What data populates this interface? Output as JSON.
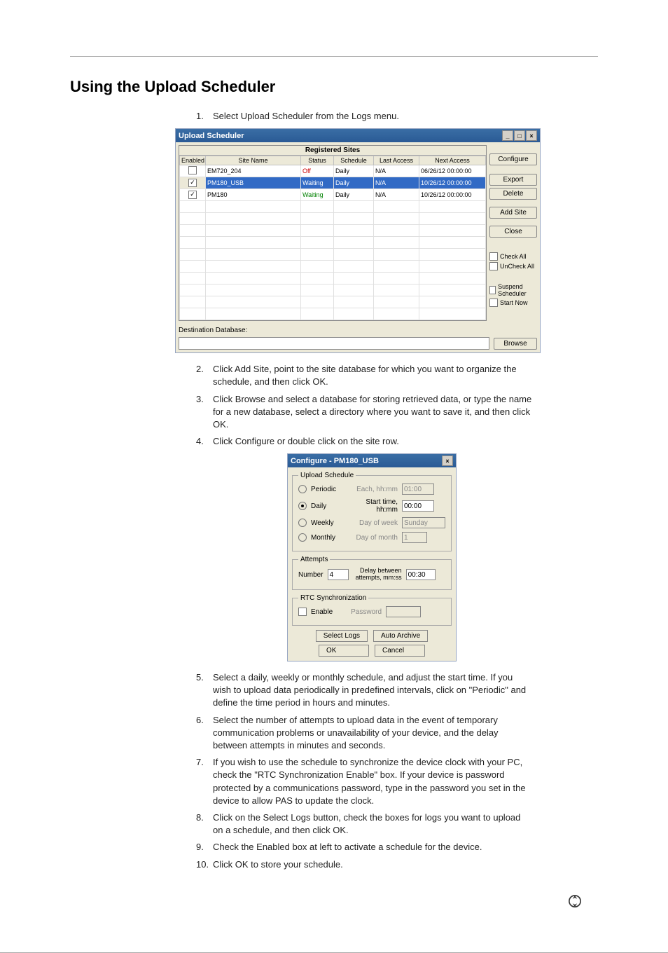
{
  "heading": "Using the Upload Scheduler",
  "steps": {
    "s1": "Select Upload Scheduler from the Logs menu.",
    "s2": "Click Add Site, point to the site database for which you want to organize the schedule, and then click OK.",
    "s3": "Click Browse and select a database for storing retrieved data, or type the name for a new database, select a directory where you want to save it, and then click OK.",
    "s4": "Click Configure or double click on the site row.",
    "s5": "Select a daily, weekly or monthly schedule, and adjust the start time. If you wish to upload data periodically in predefined intervals, click on \"Periodic\" and define the time period in hours and minutes.",
    "s6": "Select the number of attempts to upload data in the event of temporary communication problems or unavailability of your device, and the delay between attempts in minutes and seconds.",
    "s7": "If you wish to use the schedule to synchronize the device clock with your PC, check the \"RTC Synchronization Enable\" box. If your device is password protected by a communications password, type in the password you set in the device to allow PAS to update the clock.",
    "s8": "Click on the Select Logs button, check the boxes for logs you want to upload on a schedule, and then click OK.",
    "s9": "Check the Enabled box at left to activate a schedule for the device.",
    "s10": "Click OK to store your schedule."
  },
  "scheduler": {
    "title": "Upload Scheduler",
    "grid_title": "Registered Sites",
    "headers": {
      "enabled": "Enabled",
      "site": "Site Name",
      "status": "Status",
      "schedule": "Schedule",
      "last": "Last Access",
      "next": "Next Access"
    },
    "rows": [
      {
        "checked": false,
        "site": "EM720_204",
        "status": "Off",
        "status_class": "red",
        "schedule": "Daily",
        "last": "N/A",
        "next": "06/26/12 00:00:00",
        "selected": false
      },
      {
        "checked": true,
        "site": "PM180_USB",
        "status": "Waiting",
        "status_class": "green",
        "schedule": "Daily",
        "last": "N/A",
        "next": "10/26/12 00:00:00",
        "selected": true
      },
      {
        "checked": true,
        "site": "PM180",
        "status": "Waiting",
        "status_class": "green",
        "schedule": "Daily",
        "last": "N/A",
        "next": "10/26/12 00:00:00",
        "selected": false
      }
    ],
    "buttons": {
      "configure": "Configure",
      "export": "Export",
      "delete": "Delete",
      "add": "Add Site",
      "close": "Close",
      "browse": "Browse"
    },
    "checks": {
      "checkall": "Check All",
      "uncheckall": "UnCheck All",
      "suspend": "Suspend Scheduler",
      "startnow": "Start Now"
    },
    "dest_label": "Destination Database:"
  },
  "configure": {
    "title": "Configure - PM180_USB",
    "group_upload": "Upload Schedule",
    "periodic": "Periodic",
    "periodic_lbl": "Each, hh:mm",
    "periodic_val": "01:00",
    "daily": "Daily",
    "daily_lbl": "Start time, hh:mm",
    "daily_val": "00:00",
    "weekly": "Weekly",
    "weekly_lbl": "Day of week",
    "weekly_val": "Sunday",
    "monthly": "Monthly",
    "monthly_lbl": "Day of month",
    "monthly_val": "1",
    "group_attempts": "Attempts",
    "attempts_num_lbl": "Number",
    "attempts_num_val": "4",
    "attempts_delay_lbl": "Delay between attempts, mm:ss",
    "attempts_delay_val": "00:30",
    "group_rtc": "RTC Synchronization",
    "rtc_enable": "Enable",
    "rtc_pw_lbl": "Password",
    "btn_selectlogs": "Select Logs",
    "btn_autoarchive": "Auto Archive",
    "btn_ok": "OK",
    "btn_cancel": "Cancel"
  }
}
